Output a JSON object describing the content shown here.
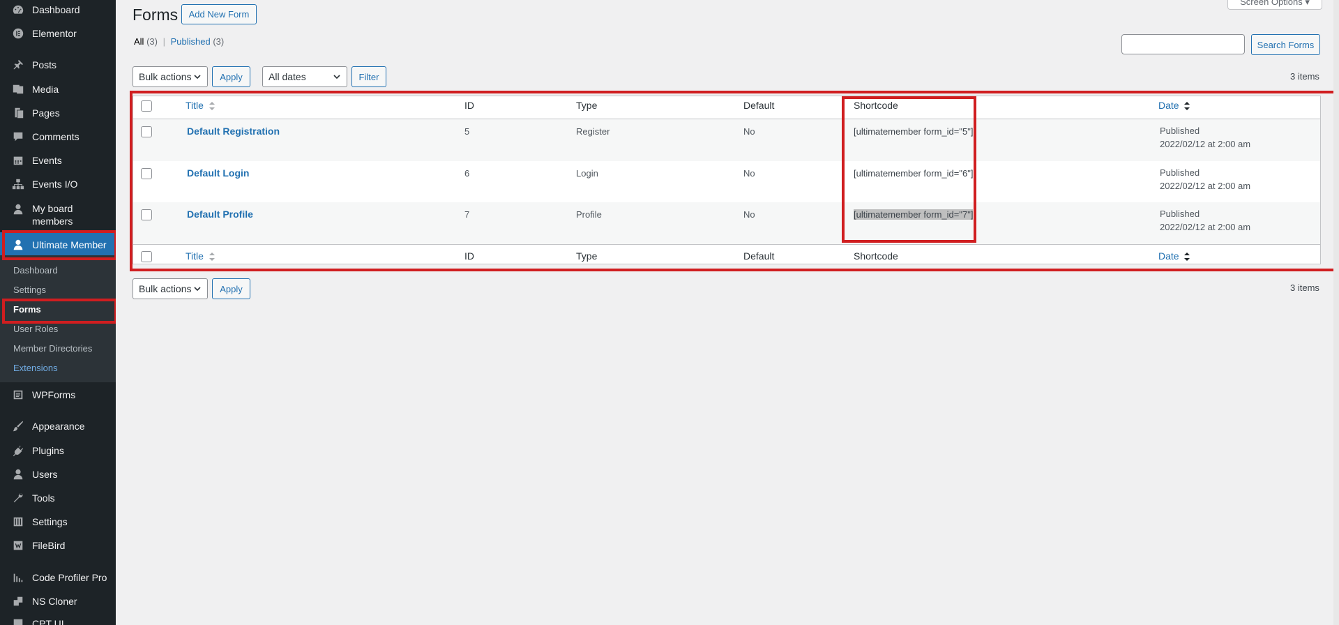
{
  "sidebar": {
    "items": [
      {
        "label": "Dashboard",
        "icon": "dashboard-icon"
      },
      {
        "label": "Elementor",
        "icon": "elementor-icon"
      },
      {
        "label": "Posts",
        "icon": "pin-icon"
      },
      {
        "label": "Media",
        "icon": "media-icon"
      },
      {
        "label": "Pages",
        "icon": "pages-icon"
      },
      {
        "label": "Comments",
        "icon": "comments-icon"
      },
      {
        "label": "Events",
        "icon": "calendar-icon"
      },
      {
        "label": "Events I/O",
        "icon": "sitemap-icon"
      },
      {
        "label_line1": "My board",
        "label_line2": "members",
        "icon": "user-icon"
      },
      {
        "label": "Ultimate Member",
        "icon": "user-icon"
      },
      {
        "label": "WPForms",
        "icon": "wpforms-icon"
      },
      {
        "label": "Appearance",
        "icon": "brush-icon"
      },
      {
        "label": "Plugins",
        "icon": "plugin-icon"
      },
      {
        "label": "Users",
        "icon": "users-icon"
      },
      {
        "label": "Tools",
        "icon": "wrench-icon"
      },
      {
        "label": "Settings",
        "icon": "settings-icon"
      },
      {
        "label": "FileBird",
        "icon": "filebird-icon"
      },
      {
        "label": "Code Profiler Pro",
        "icon": "bar-chart-icon"
      },
      {
        "label": "NS Cloner",
        "icon": "cloner-icon"
      },
      {
        "label": "CPT UI",
        "icon": "cpt-icon"
      }
    ],
    "submenu": [
      "Dashboard",
      "Settings",
      "Forms",
      "User Roles",
      "Member Directories",
      "Extensions"
    ]
  },
  "header": {
    "title": "Forms",
    "add_new": "Add New Form",
    "screen_options": "Screen Options ▾"
  },
  "filters": {
    "all_label": "All",
    "all_count": "(3)",
    "separator": "|",
    "published_label": "Published",
    "published_count": "(3)",
    "search_placeholder": "",
    "search_button": "Search Forms",
    "bulk_actions": "Bulk actions",
    "apply": "Apply",
    "all_dates": "All dates",
    "filter": "Filter",
    "items_count": "3 items"
  },
  "table": {
    "columns": [
      "Title",
      "ID",
      "Type",
      "Default",
      "Shortcode",
      "Date"
    ],
    "rows": [
      {
        "title": "Default Registration",
        "id": "5",
        "type": "Register",
        "default": "No",
        "shortcode": "[ultimatemember form_id=\"5\"]",
        "status": "Published",
        "date": "2022/02/12 at 2:00 am"
      },
      {
        "title": "Default Login",
        "id": "6",
        "type": "Login",
        "default": "No",
        "shortcode": "[ultimatemember form_id=\"6\"]",
        "status": "Published",
        "date": "2022/02/12 at 2:00 am"
      },
      {
        "title": "Default Profile",
        "id": "7",
        "type": "Profile",
        "default": "No",
        "shortcode": "[ultimatemember form_id=\"7\"]",
        "status": "Published",
        "date": "2022/02/12 at 2:00 am"
      }
    ]
  },
  "colors": {
    "sidebar_bg": "#1d2327",
    "accent": "#2271b1",
    "highlight_box": "#d01e20"
  }
}
